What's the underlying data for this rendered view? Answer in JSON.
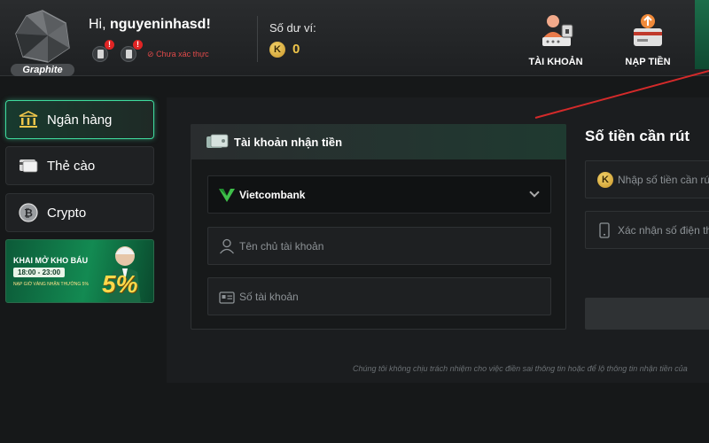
{
  "header": {
    "rank_label": "Graphite",
    "greeting_prefix": "Hi, ",
    "username": "nguyeninhasd!",
    "unverified_text": "Chưa xác thực",
    "balance_label": "Số dư ví:",
    "coin_symbol": "K",
    "balance_value": "0",
    "nav": [
      {
        "label": "TÀI KHOẢN"
      },
      {
        "label": "NẠP TIỀN"
      }
    ]
  },
  "sidebar": {
    "items": [
      {
        "label": "Ngân hàng"
      },
      {
        "label": "Thẻ cào"
      },
      {
        "label": "Crypto"
      }
    ],
    "promo": {
      "line1": "KHAI MỞ KHO BÁU",
      "line2": "18:00 - 23:00",
      "line3": "NẠP GIỜ VÀNG NHẬN THƯỞNG 5%",
      "percent": "5%"
    }
  },
  "form": {
    "section_title": "Tài khoản nhận tiền",
    "bank_selected": "Vietcombank",
    "account_name_placeholder": "Tên chủ tài khoản",
    "account_number_placeholder": "Số tài khoản",
    "amount_title": "Số tiền cần rút",
    "coin_symbol": "K",
    "amount_placeholder": "Nhập số tiền cần rút",
    "phone_placeholder": "Xác nhận số điện thoại",
    "disclaimer": "Chúng tôi không chịu trách nhiệm cho việc điền sai thông tin hoặc để lộ thông tin nhận tiền của"
  }
}
